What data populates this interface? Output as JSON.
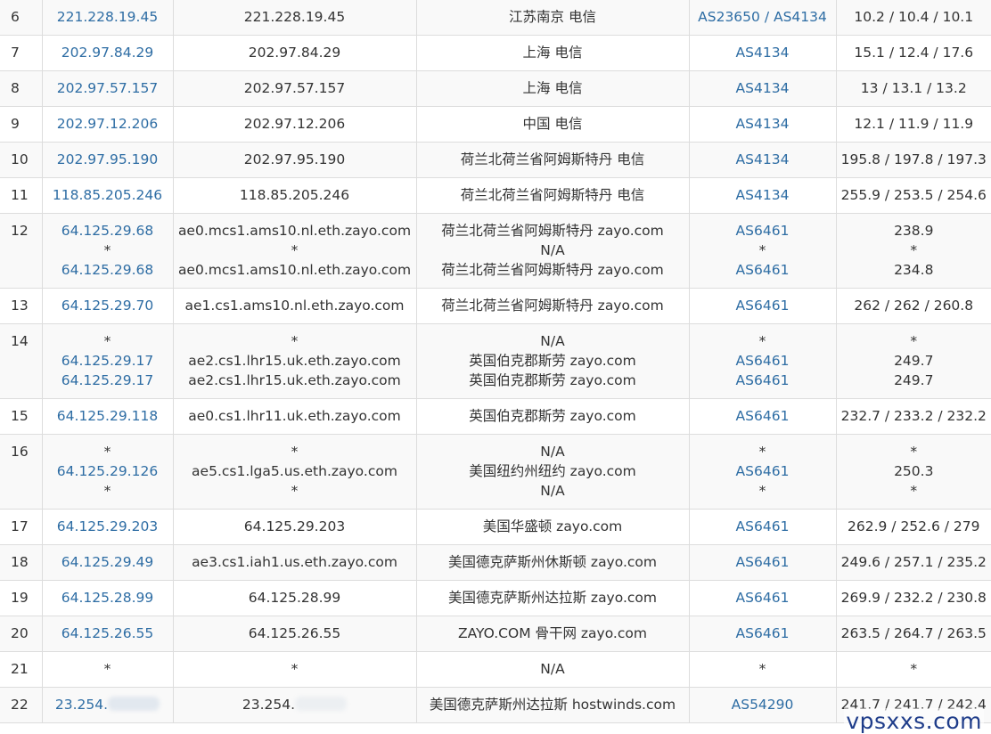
{
  "rows": [
    {
      "hop": "6",
      "ip": [
        "221.228.19.45"
      ],
      "host": [
        "221.228.19.45"
      ],
      "geo": [
        "江苏南京 电信"
      ],
      "asn": [
        "AS23650 / AS4134"
      ],
      "rtt": [
        "10.2 / 10.4 / 10.1"
      ]
    },
    {
      "hop": "7",
      "ip": [
        "202.97.84.29"
      ],
      "host": [
        "202.97.84.29"
      ],
      "geo": [
        "上海 电信"
      ],
      "asn": [
        "AS4134"
      ],
      "rtt": [
        "15.1 / 12.4 / 17.6"
      ]
    },
    {
      "hop": "8",
      "ip": [
        "202.97.57.157"
      ],
      "host": [
        "202.97.57.157"
      ],
      "geo": [
        "上海 电信"
      ],
      "asn": [
        "AS4134"
      ],
      "rtt": [
        "13 / 13.1 / 13.2"
      ]
    },
    {
      "hop": "9",
      "ip": [
        "202.97.12.206"
      ],
      "host": [
        "202.97.12.206"
      ],
      "geo": [
        "中国 电信"
      ],
      "asn": [
        "AS4134"
      ],
      "rtt": [
        "12.1 / 11.9 / 11.9"
      ]
    },
    {
      "hop": "10",
      "ip": [
        "202.97.95.190"
      ],
      "host": [
        "202.97.95.190"
      ],
      "geo": [
        "荷兰北荷兰省阿姆斯特丹 电信"
      ],
      "asn": [
        "AS4134"
      ],
      "rtt": [
        "195.8 / 197.8 / 197.3"
      ]
    },
    {
      "hop": "11",
      "ip": [
        "118.85.205.246"
      ],
      "host": [
        "118.85.205.246"
      ],
      "geo": [
        "荷兰北荷兰省阿姆斯特丹 电信"
      ],
      "asn": [
        "AS4134"
      ],
      "rtt": [
        "255.9 / 253.5 / 254.6"
      ]
    },
    {
      "hop": "12",
      "ip": [
        "64.125.29.68",
        "*",
        "64.125.29.68"
      ],
      "host": [
        "ae0.mcs1.ams10.nl.eth.zayo.com",
        "*",
        "ae0.mcs1.ams10.nl.eth.zayo.com"
      ],
      "geo": [
        "荷兰北荷兰省阿姆斯特丹 zayo.com",
        "N/A",
        "荷兰北荷兰省阿姆斯特丹 zayo.com"
      ],
      "asn": [
        "AS6461",
        "*",
        "AS6461"
      ],
      "rtt": [
        "238.9",
        "*",
        "234.8"
      ]
    },
    {
      "hop": "13",
      "ip": [
        "64.125.29.70"
      ],
      "host": [
        "ae1.cs1.ams10.nl.eth.zayo.com"
      ],
      "geo": [
        "荷兰北荷兰省阿姆斯特丹 zayo.com"
      ],
      "asn": [
        "AS6461"
      ],
      "rtt": [
        "262 / 262 / 260.8"
      ]
    },
    {
      "hop": "14",
      "ip": [
        "*",
        "64.125.29.17",
        "64.125.29.17"
      ],
      "host": [
        "*",
        "ae2.cs1.lhr15.uk.eth.zayo.com",
        "ae2.cs1.lhr15.uk.eth.zayo.com"
      ],
      "geo": [
        "N/A",
        "英国伯克郡斯劳 zayo.com",
        "英国伯克郡斯劳 zayo.com"
      ],
      "asn": [
        "*",
        "AS6461",
        "AS6461"
      ],
      "rtt": [
        "*",
        "249.7",
        "249.7"
      ]
    },
    {
      "hop": "15",
      "ip": [
        "64.125.29.118"
      ],
      "host": [
        "ae0.cs1.lhr11.uk.eth.zayo.com"
      ],
      "geo": [
        "英国伯克郡斯劳 zayo.com"
      ],
      "asn": [
        "AS6461"
      ],
      "rtt": [
        "232.7 / 233.2 / 232.2"
      ]
    },
    {
      "hop": "16",
      "ip": [
        "*",
        "64.125.29.126",
        "*"
      ],
      "host": [
        "*",
        "ae5.cs1.lga5.us.eth.zayo.com",
        "*"
      ],
      "geo": [
        "N/A",
        "美国纽约州纽约 zayo.com",
        "N/A"
      ],
      "asn": [
        "*",
        "AS6461",
        "*"
      ],
      "rtt": [
        "*",
        "250.3",
        "*"
      ]
    },
    {
      "hop": "17",
      "ip": [
        "64.125.29.203"
      ],
      "host": [
        "64.125.29.203"
      ],
      "geo": [
        "美国华盛顿 zayo.com"
      ],
      "asn": [
        "AS6461"
      ],
      "rtt": [
        "262.9 / 252.6 / 279"
      ]
    },
    {
      "hop": "18",
      "ip": [
        "64.125.29.49"
      ],
      "host": [
        "ae3.cs1.iah1.us.eth.zayo.com"
      ],
      "geo": [
        "美国德克萨斯州休斯顿 zayo.com"
      ],
      "asn": [
        "AS6461"
      ],
      "rtt": [
        "249.6 / 257.1 / 235.2"
      ]
    },
    {
      "hop": "19",
      "ip": [
        "64.125.28.99"
      ],
      "host": [
        "64.125.28.99"
      ],
      "geo": [
        "美国德克萨斯州达拉斯 zayo.com"
      ],
      "asn": [
        "AS6461"
      ],
      "rtt": [
        "269.9 / 232.2 / 230.8"
      ]
    },
    {
      "hop": "20",
      "ip": [
        "64.125.26.55"
      ],
      "host": [
        "64.125.26.55"
      ],
      "geo": [
        "ZAYO.COM 骨干网 zayo.com"
      ],
      "asn": [
        "AS6461"
      ],
      "rtt": [
        "263.5 / 264.7 / 263.5"
      ]
    },
    {
      "hop": "21",
      "ip": [
        "*"
      ],
      "host": [
        "*"
      ],
      "geo": [
        "N/A"
      ],
      "asn": [
        "*"
      ],
      "rtt": [
        "*"
      ]
    },
    {
      "hop": "22",
      "ip": [
        "23.254."
      ],
      "host": [
        "23.254."
      ],
      "geo": [
        "美国德克萨斯州达拉斯 hostwinds.com"
      ],
      "asn": [
        "AS54290"
      ],
      "rtt": [
        "241.7 / 241.7 / 242.4"
      ]
    }
  ],
  "watermark": "vpsxxs.com",
  "colors": {
    "link": "#2e6da4",
    "text": "#333333",
    "border": "#dddddd",
    "stripe": "#f9f9f9",
    "watermark": "#1f3d8a"
  }
}
